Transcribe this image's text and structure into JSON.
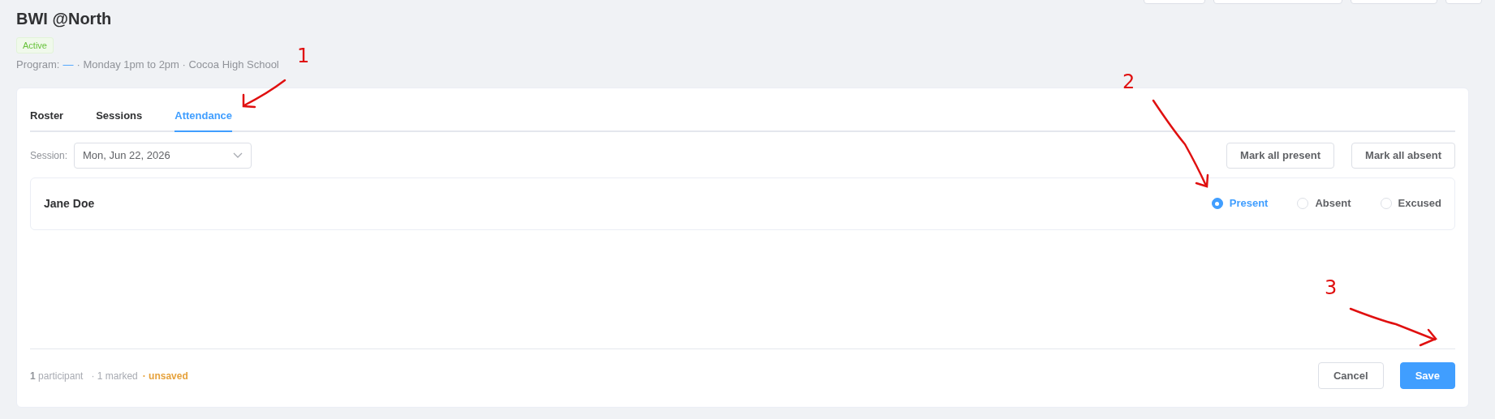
{
  "header": {
    "title": "BWI @North",
    "status": {
      "label": "Active"
    },
    "program": {
      "label": "Program:",
      "value": "—",
      "details": "· Monday 1pm to 2pm · Cocoa High School"
    },
    "actions": [
      {
        "kind": "cut_off"
      },
      {
        "kind": "cut_off"
      },
      {
        "kind": "cut_off"
      },
      {
        "kind": "cut_off"
      }
    ]
  },
  "tabs": [
    {
      "label": "Roster",
      "selected": false
    },
    {
      "label": "Sessions",
      "selected": false
    },
    {
      "label": "Attendance",
      "selected": true
    }
  ],
  "session": {
    "label": "Session:",
    "value": "Mon, Jun 22, 2026"
  },
  "bulk_actions": [
    "Mark all present",
    "Mark all absent"
  ],
  "participants": [
    {
      "name": "Jane Doe",
      "options": [
        {
          "label": "Present",
          "selected": true
        },
        {
          "label": "Absent",
          "selected": false
        },
        {
          "label": "Excused",
          "selected": false
        }
      ]
    }
  ],
  "footer": {
    "count": "1",
    "count_label": "participant",
    "marked": "· 1 marked",
    "unsaved": "· unsaved",
    "buttons": [
      {
        "label": "Cancel",
        "kind": "secondary"
      },
      {
        "label": "Save",
        "kind": "primary"
      }
    ]
  },
  "annotations": [
    "1",
    "2",
    "3"
  ]
}
